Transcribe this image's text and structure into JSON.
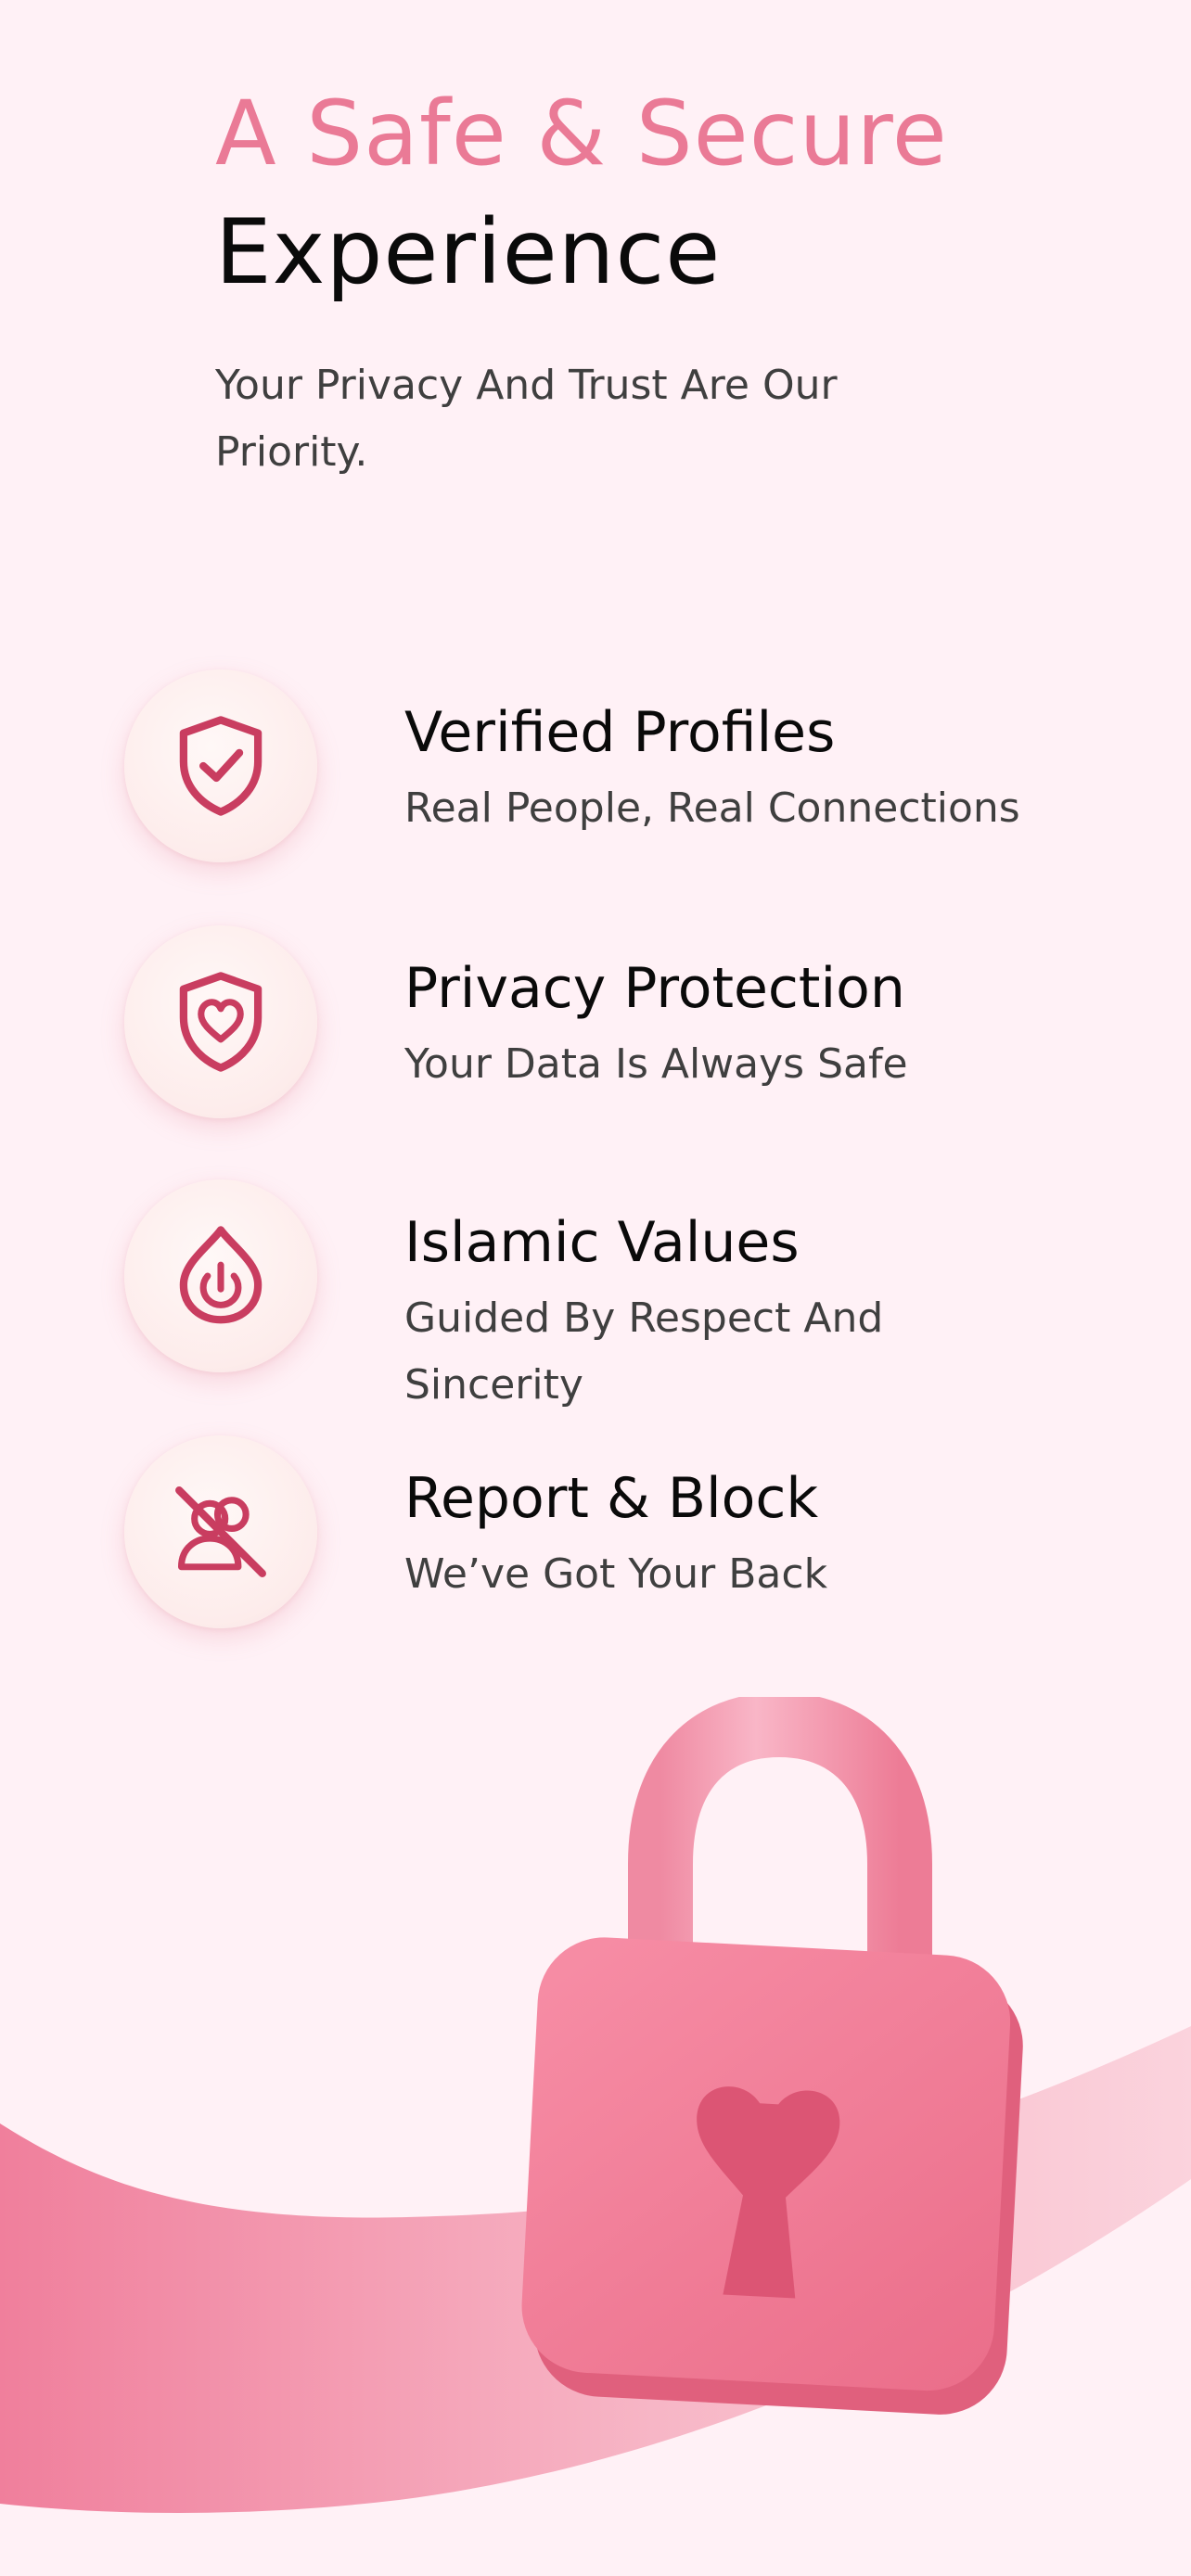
{
  "header": {
    "title_line1": "A Safe & Secure",
    "title_line2": "Experience",
    "subtitle": "Your Privacy And Trust Are Our Priority."
  },
  "features": [
    {
      "icon": "shield-check-icon",
      "title": "Verified Profiles",
      "description": "Real People, Real Connections"
    },
    {
      "icon": "shield-heart-icon",
      "title": "Privacy Protection",
      "description": "Your Data Is Always Safe"
    },
    {
      "icon": "drop-power-icon",
      "title": "Islamic Values",
      "description": "Guided By Respect And Sincerity"
    },
    {
      "icon": "user-blocked-icon",
      "title": "Report & Block",
      "description": "We’ve Got Your Back"
    }
  ],
  "colors": {
    "background": "#fff1f6",
    "accent": "#ea7a96",
    "icon": "#c93d60",
    "lock": "#f07f98"
  }
}
